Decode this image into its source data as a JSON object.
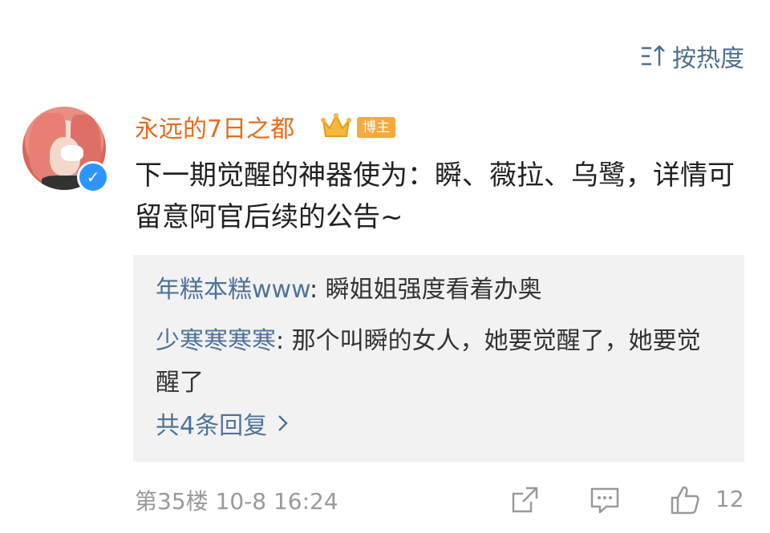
{
  "sort": {
    "label": "按热度"
  },
  "comment": {
    "username": "永远的7日之都",
    "badge": "博主",
    "text": "下一期觉醒的神器使为：瞬、薇拉、乌鹭，详情可留意阿官后续的公告~"
  },
  "replies": [
    {
      "name": "年糕本糕www",
      "text": ": 瞬姐姐强度看着办奥"
    },
    {
      "name": "少寒寒寒寒",
      "text": ": 那个叫瞬的女人，她要觉醒了，她要觉醒了"
    }
  ],
  "view_more": {
    "label": "共4条回复",
    "icon": "chevron-right-icon"
  },
  "footer": {
    "floor_time": "第35楼 10-8 16:24",
    "like_count": "12"
  },
  "colors": {
    "username": "#e86b1a",
    "link": "#4f7399",
    "badge_bg": "#f7a93a",
    "verified": "#2e95ff"
  }
}
